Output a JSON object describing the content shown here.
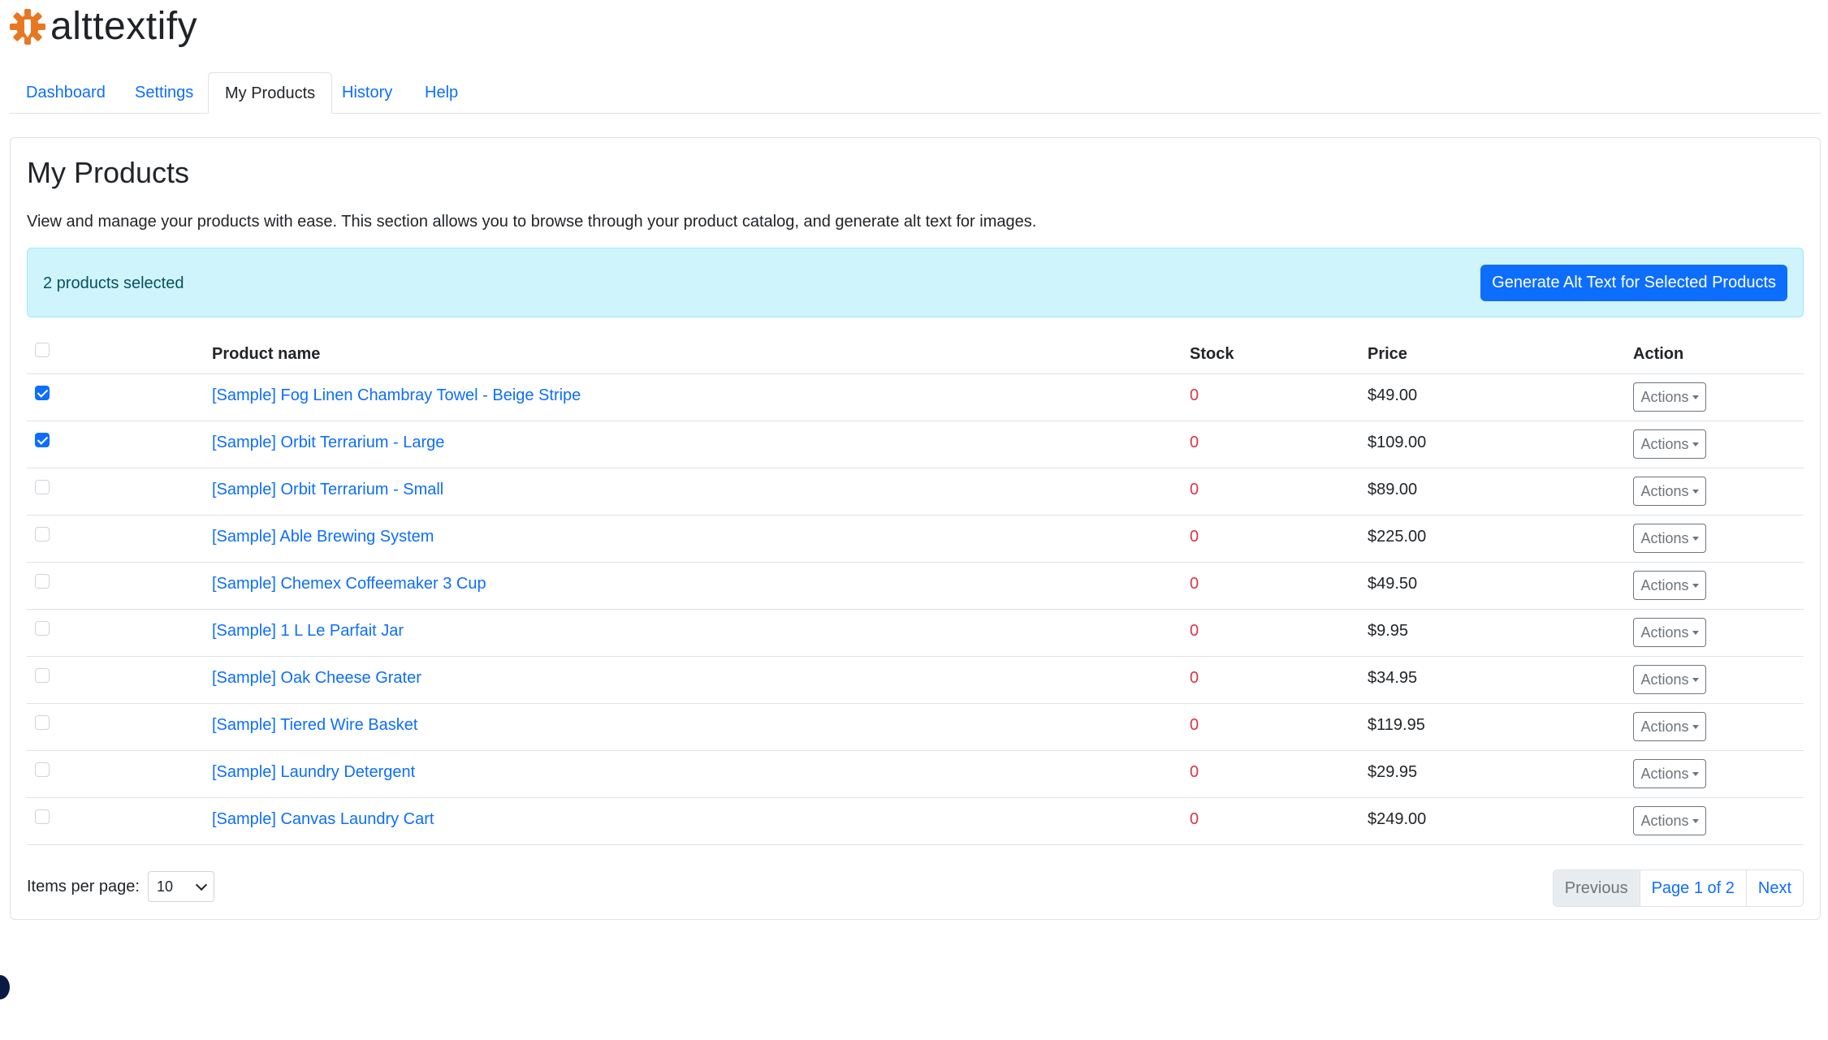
{
  "brand": {
    "name": "alttextify",
    "logo_icon": "gear-pencil-logo",
    "accent": "#e87722"
  },
  "tabs": [
    {
      "label": "Dashboard",
      "active": false
    },
    {
      "label": "Settings",
      "active": false
    },
    {
      "label": "My Products",
      "active": true
    },
    {
      "label": "History",
      "active": false
    },
    {
      "label": "Help",
      "active": false
    }
  ],
  "main": {
    "title": "My Products",
    "description": "View and manage your products with ease. This section allows you to browse through your product catalog, and generate alt text for images.",
    "alert": {
      "text": "2 products selected",
      "button_label": "Generate Alt Text for Selected Products"
    }
  },
  "table": {
    "headers": {
      "name": "Product name",
      "stock": "Stock",
      "price": "Price",
      "action": "Action"
    },
    "action_label": "Actions",
    "rows": [
      {
        "name": "[Sample] Fog Linen Chambray Towel - Beige Stripe",
        "stock": "0",
        "price": "$49.00",
        "checked": true
      },
      {
        "name": "[Sample] Orbit Terrarium - Large",
        "stock": "0",
        "price": "$109.00",
        "checked": true
      },
      {
        "name": "[Sample] Orbit Terrarium - Small",
        "stock": "0",
        "price": "$89.00",
        "checked": false
      },
      {
        "name": "[Sample] Able Brewing System",
        "stock": "0",
        "price": "$225.00",
        "checked": false
      },
      {
        "name": "[Sample] Chemex Coffeemaker 3 Cup",
        "stock": "0",
        "price": "$49.50",
        "checked": false
      },
      {
        "name": "[Sample] 1 L Le Parfait Jar",
        "stock": "0",
        "price": "$9.95",
        "checked": false
      },
      {
        "name": "[Sample] Oak Cheese Grater",
        "stock": "0",
        "price": "$34.95",
        "checked": false
      },
      {
        "name": "[Sample] Tiered Wire Basket",
        "stock": "0",
        "price": "$119.95",
        "checked": false
      },
      {
        "name": "[Sample] Laundry Detergent",
        "stock": "0",
        "price": "$29.95",
        "checked": false
      },
      {
        "name": "[Sample] Canvas Laundry Cart",
        "stock": "0",
        "price": "$249.00",
        "checked": false
      }
    ]
  },
  "footer": {
    "items_per_page_label": "Items per page:",
    "items_per_page_value": "10",
    "pagination": {
      "previous": "Previous",
      "page": "Page 1 of 2",
      "next": "Next"
    }
  },
  "colors": {
    "primary": "#0d6efd",
    "danger": "#dc3545",
    "info_bg": "#cff4fc"
  }
}
